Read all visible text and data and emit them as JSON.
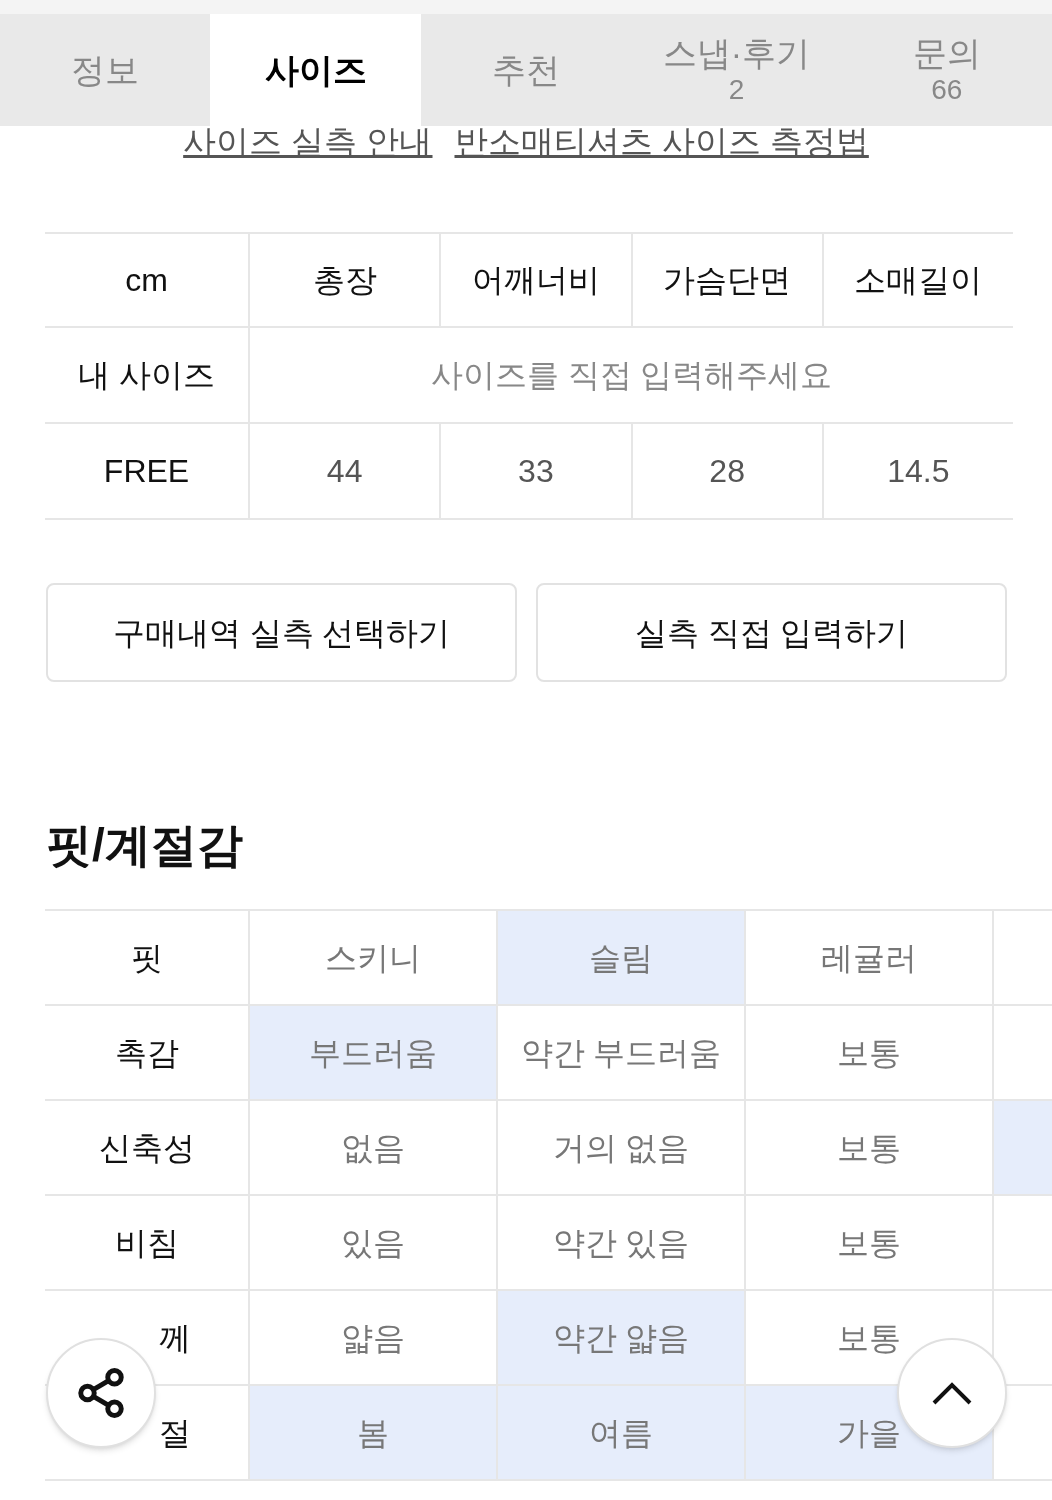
{
  "tabs": [
    {
      "label": "정보",
      "selected": false
    },
    {
      "label": "사이즈",
      "selected": true
    },
    {
      "label": "추천",
      "selected": false
    },
    {
      "label": "스냅·후기",
      "count": "2",
      "selected": false
    },
    {
      "label": "문의",
      "count": "66",
      "selected": false
    }
  ],
  "guide_links": [
    "사이즈 실측 안내",
    "반소매티셔츠 사이즈 측정법"
  ],
  "size_table": {
    "columns": [
      "cm",
      "총장",
      "어깨너비",
      "가슴단면",
      "소매길이"
    ],
    "my_size": {
      "label": "내 사이즈",
      "placeholder": "사이즈를 직접 입력해주세요"
    },
    "rows": [
      {
        "size": "FREE",
        "values": [
          "44",
          "33",
          "28",
          "14.5"
        ]
      }
    ]
  },
  "buttons": [
    "구매내역 실측 선택하기",
    "실측 직접 입력하기"
  ],
  "fit_section": {
    "title": "핏/계절감",
    "rows": [
      {
        "label": "핏",
        "options": [
          {
            "label": "스키니",
            "selected": false
          },
          {
            "label": "슬림",
            "selected": true
          },
          {
            "label": "레귤러",
            "selected": false
          }
        ],
        "next_option_selected": false
      },
      {
        "label": "촉감",
        "options": [
          {
            "label": "부드러움",
            "selected": true
          },
          {
            "label": "약간 부드러움",
            "selected": false
          },
          {
            "label": "보통",
            "selected": false
          }
        ],
        "next_option_selected": false
      },
      {
        "label": "신축성",
        "options": [
          {
            "label": "없음",
            "selected": false
          },
          {
            "label": "거의 없음",
            "selected": false
          },
          {
            "label": "보통",
            "selected": false
          }
        ],
        "next_option_selected": true
      },
      {
        "label": "비침",
        "options": [
          {
            "label": "있음",
            "selected": false
          },
          {
            "label": "약간 있음",
            "selected": false
          },
          {
            "label": "보통",
            "selected": false
          }
        ],
        "next_option_selected": false
      },
      {
        "label": "께",
        "partly_covered": true,
        "options": [
          {
            "label": "얇음",
            "selected": false
          },
          {
            "label": "약간 얇음",
            "selected": true
          },
          {
            "label": "보통",
            "selected": false
          }
        ],
        "next_option_selected": false
      },
      {
        "label": "절",
        "partly_covered": true,
        "options": [
          {
            "label": "봄",
            "selected": true
          },
          {
            "label": "여름",
            "selected": true
          },
          {
            "label": "가을",
            "selected": true
          }
        ],
        "next_option_selected": false
      }
    ]
  }
}
